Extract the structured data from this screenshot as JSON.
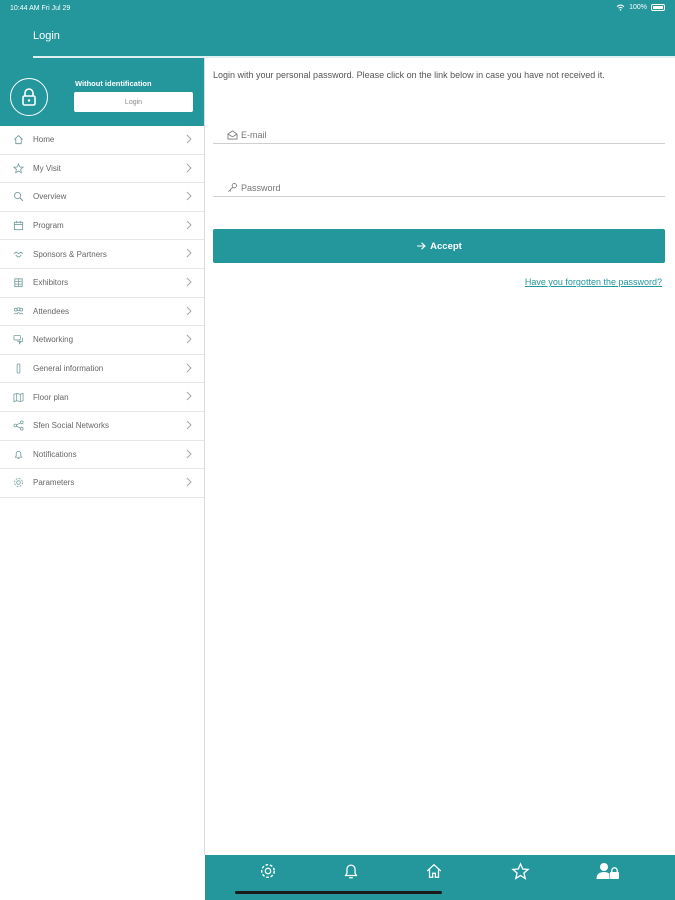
{
  "status_bar": {
    "time": "10:44 AM   Fri Jul 29",
    "battery": "100%"
  },
  "nav": {
    "title": "Login"
  },
  "sidebar": {
    "header": {
      "status": "Without identification",
      "login_label": "Login"
    },
    "items": [
      {
        "label": "Home",
        "icon": "home-icon"
      },
      {
        "label": "My Visit",
        "icon": "star-icon"
      },
      {
        "label": "Overview",
        "icon": "search-icon"
      },
      {
        "label": "Program",
        "icon": "calendar-icon"
      },
      {
        "label": "Sponsors & Partners",
        "icon": "handshake-icon"
      },
      {
        "label": "Exhibitors",
        "icon": "building-icon"
      },
      {
        "label": "Attendees",
        "icon": "users-icon"
      },
      {
        "label": "Networking",
        "icon": "chat-icon"
      },
      {
        "label": "General information",
        "icon": "info-icon"
      },
      {
        "label": "Floor plan",
        "icon": "map-icon"
      },
      {
        "label": "Sfen Social Networks",
        "icon": "share-icon"
      },
      {
        "label": "Notifications",
        "icon": "bell-icon"
      },
      {
        "label": "Parameters",
        "icon": "gear-icon"
      }
    ]
  },
  "main": {
    "intro": "Login with your personal password. Please click on the link below in case you have not received it.",
    "email_placeholder": "E-mail",
    "password_placeholder": "Password",
    "accept_label": "Accept",
    "forgot_label": "Have you forgotten the password?"
  },
  "tab_bar": {
    "tabs": [
      "gear-icon",
      "bell-icon",
      "home-icon",
      "star-icon",
      "user-lock-icon"
    ]
  },
  "colors": {
    "accent": "#23979c",
    "background": "#ffffff",
    "text": "#4a4a4a"
  }
}
